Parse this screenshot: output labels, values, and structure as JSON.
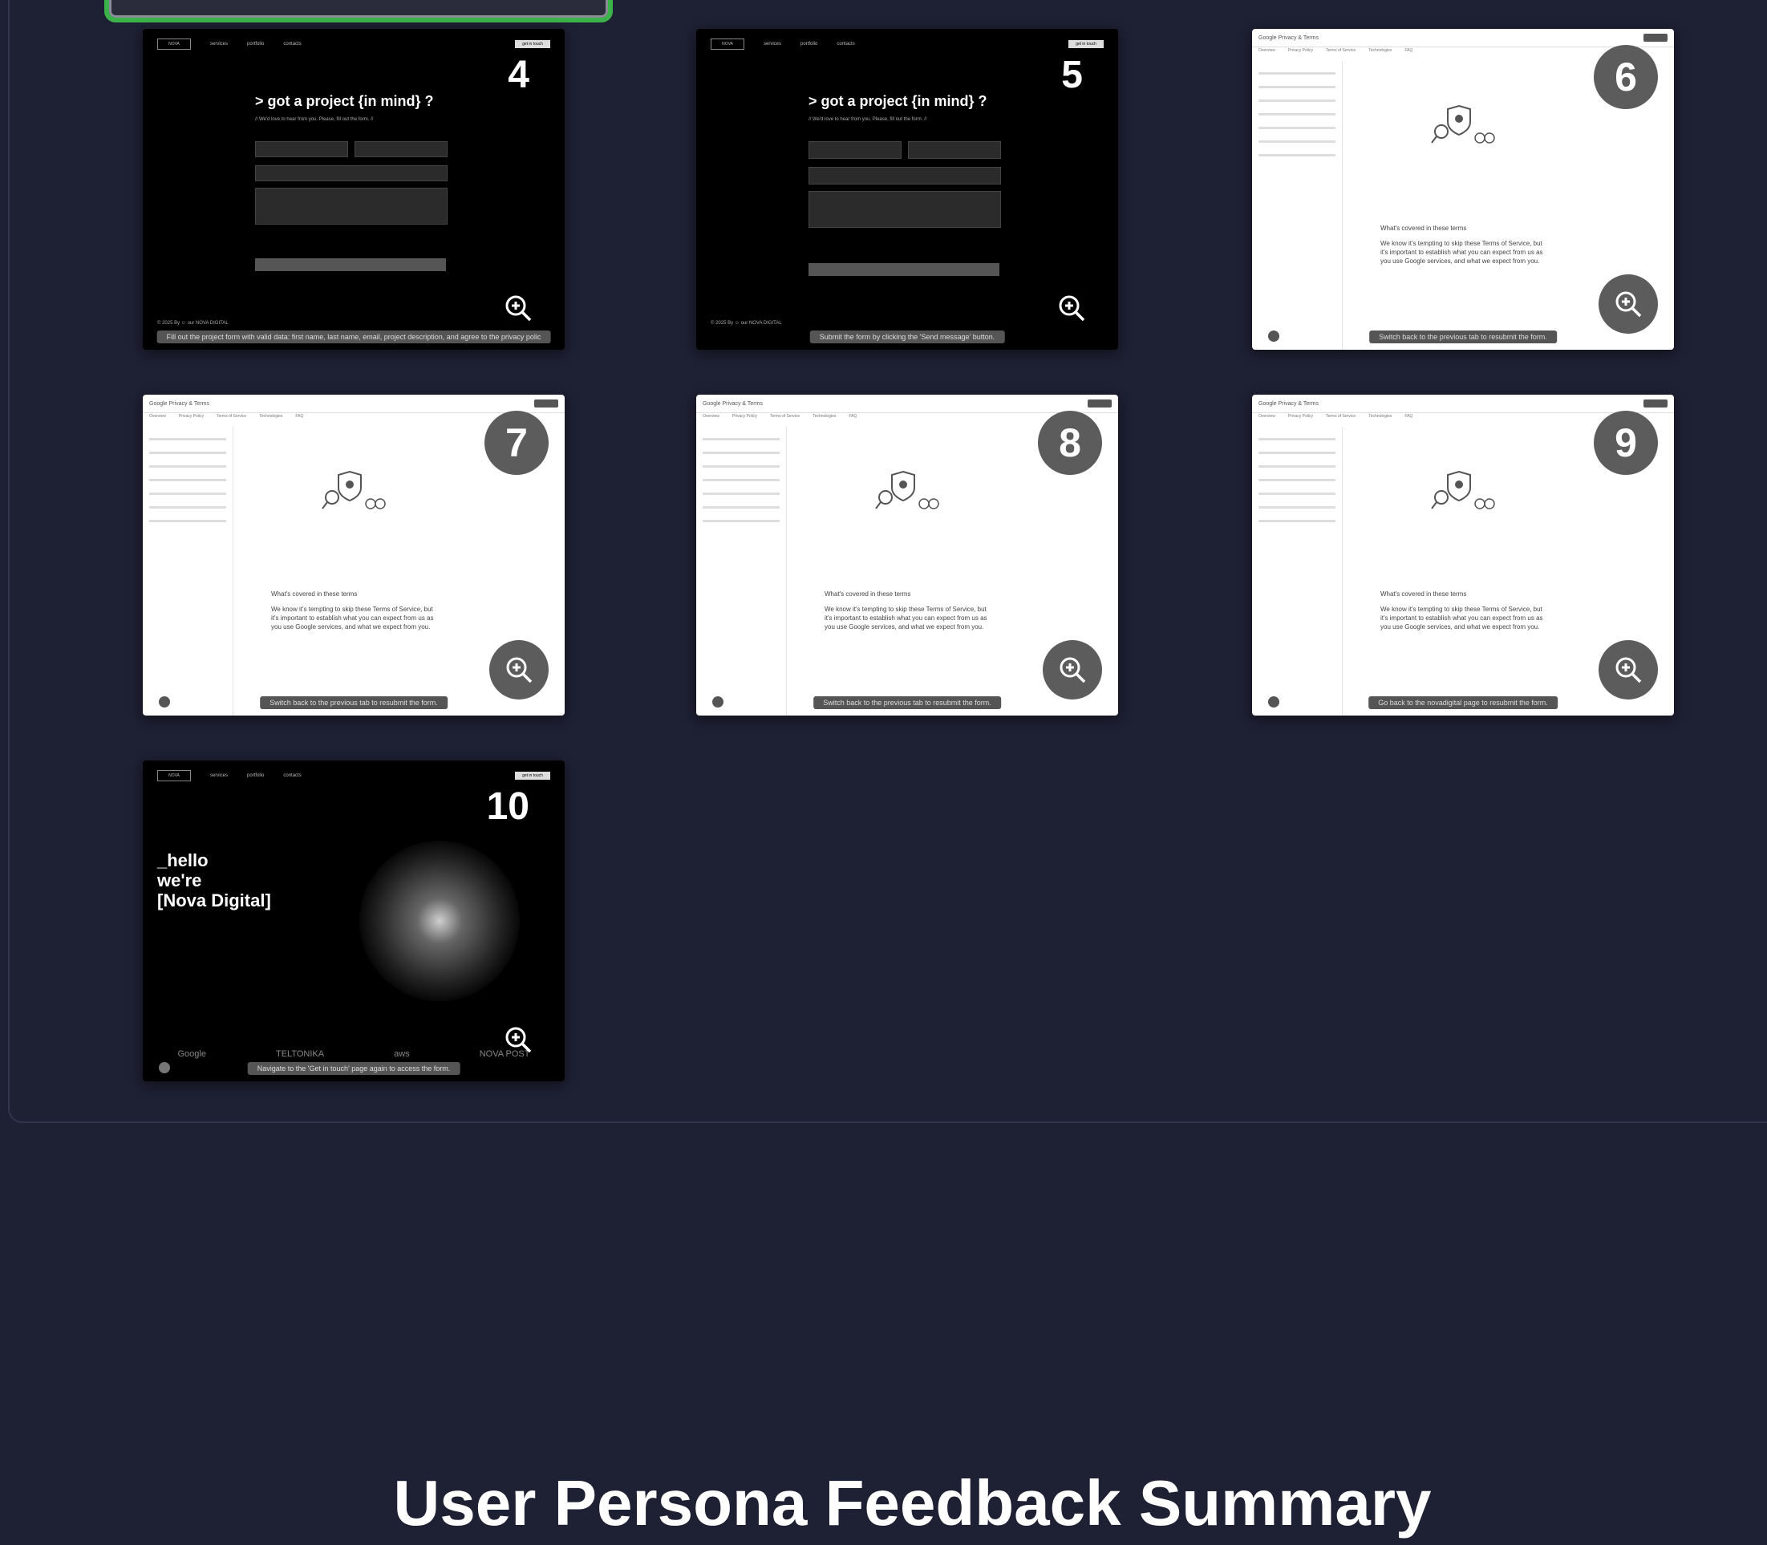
{
  "cards": [
    {
      "step": "4",
      "caption": "Fill out the project form with valid data: first name, last name, email, project description, and agree to the privacy polic"
    },
    {
      "step": "5",
      "caption": "Submit the form by clicking the 'Send message' button."
    },
    {
      "step": "6",
      "caption": "Switch back to the previous tab to resubmit the form."
    },
    {
      "step": "7",
      "caption": "Switch back to the previous tab to resubmit the form."
    },
    {
      "step": "8",
      "caption": "Switch back to the previous tab to resubmit the form."
    },
    {
      "step": "9",
      "caption": "Go back to the novadigital page to resubmit the form."
    },
    {
      "step": "10",
      "caption": "Navigate to the 'Get in touch' page again to access the form."
    }
  ],
  "form_site": {
    "title": "> got a project {in mind} ?",
    "subtitle": "// We'd love to hear from you. Please, fill out the form. //",
    "nav": [
      "services",
      "portfolio",
      "contacts"
    ],
    "cta": "get in touch",
    "footer": "© 2025 By ☺ our NOVA DIGITAL"
  },
  "doc_site": {
    "title": "Google Privacy & Terms",
    "tabs": [
      "Overview",
      "Privacy Policy",
      "Terms of Service",
      "Technologies",
      "FAQ"
    ],
    "heading": "What's covered in these terms",
    "paragraph": "We know it's tempting to skip these Terms of Service, but it's important to establish what you can expect from us as you use Google services, and what we expect from you."
  },
  "hero_site": {
    "headline_1": "_hello",
    "headline_2": "we're",
    "headline_3": "[Nova Digital]",
    "brands": [
      "Google",
      "TELTONIKA",
      "aws",
      "NOVA POST"
    ]
  },
  "summary_title": "User Persona Feedback Summary"
}
